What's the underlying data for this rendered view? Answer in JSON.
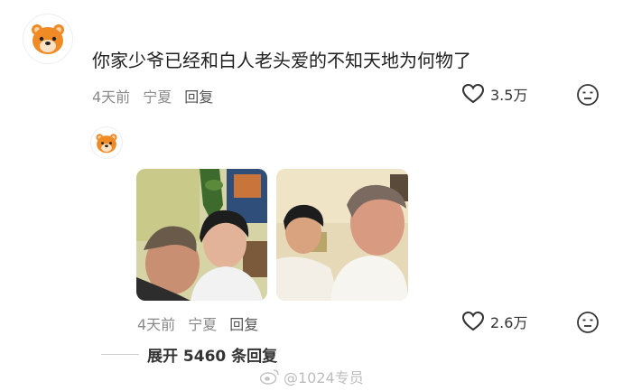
{
  "comment": {
    "text": "你家少爷已经和白人老头爱的不知天地为何物了",
    "time": "4天前",
    "location": "宁夏",
    "reply_label": "回复",
    "likes": "3.5万"
  },
  "reply": {
    "time": "4天前",
    "location": "宁夏",
    "reply_label": "回复",
    "likes": "2.6万"
  },
  "expand_label": "展开 5460 条回复",
  "watermark": "@1024专员",
  "icons": {
    "avatar": "bear-avatar-icon",
    "like": "heart-outline-icon",
    "dislike": "meh-face-icon",
    "watermark": "weibo-logo-icon"
  },
  "colors": {
    "avatar_orange": "#f08a24",
    "muted_text": "#8a8a8a"
  }
}
